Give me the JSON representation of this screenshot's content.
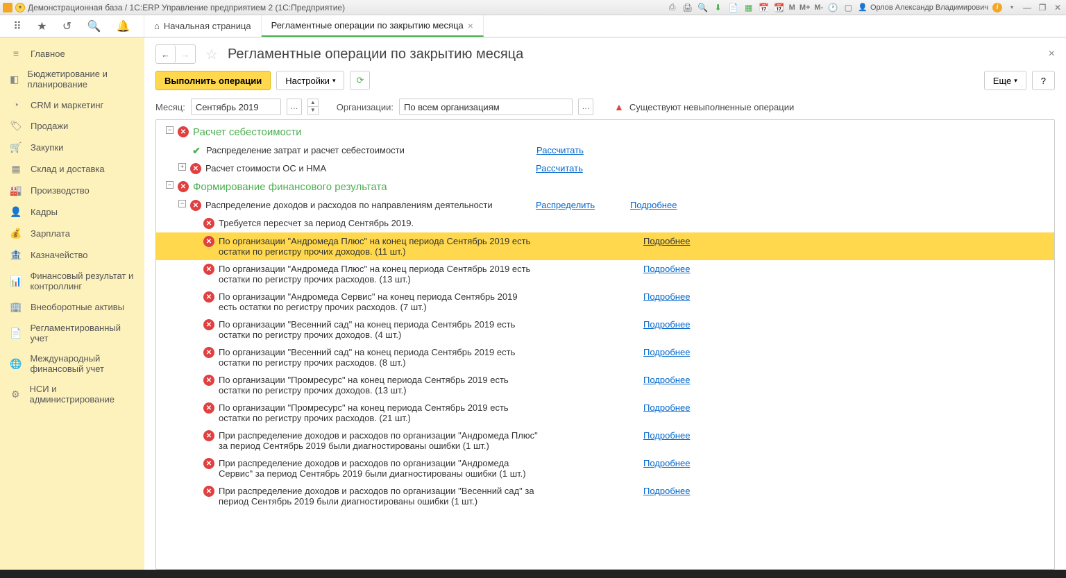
{
  "titlebar": {
    "title": "Демонстрационная база / 1С:ERP Управление предприятием 2  (1С:Предприятие)",
    "user": "Орлов Александр Владимирович",
    "m1": "M",
    "m2": "M+",
    "m3": "M-"
  },
  "tabs": {
    "home": "Начальная страница",
    "current": "Регламентные операции по закрытию месяца"
  },
  "sidebar": {
    "items": [
      {
        "icon": "≡",
        "label": "Главное"
      },
      {
        "icon": "◧",
        "label": "Бюджетирование и планирование"
      },
      {
        "icon": "◔",
        "label": "CRM и маркетинг"
      },
      {
        "icon": "🏷",
        "label": "Продажи"
      },
      {
        "icon": "🛒",
        "label": "Закупки"
      },
      {
        "icon": "▦",
        "label": "Склад и доставка"
      },
      {
        "icon": "🏭",
        "label": "Производство"
      },
      {
        "icon": "👤",
        "label": "Кадры"
      },
      {
        "icon": "💰",
        "label": "Зарплата"
      },
      {
        "icon": "🏦",
        "label": "Казначейство"
      },
      {
        "icon": "📊",
        "label": "Финансовый результат и контроллинг"
      },
      {
        "icon": "🏢",
        "label": "Внеоборотные активы"
      },
      {
        "icon": "📄",
        "label": "Регламентированный учет"
      },
      {
        "icon": "🌐",
        "label": "Международный финансовый учет"
      },
      {
        "icon": "⚙",
        "label": "НСИ и администрирование"
      }
    ]
  },
  "page": {
    "title": "Регламентные операции по закрытию месяца",
    "execute_btn": "Выполнить операции",
    "settings_btn": "Настройки",
    "more_btn": "Еще",
    "help_btn": "?",
    "month_label": "Месяц:",
    "month_value": "Сентябрь 2019",
    "org_label": "Организации:",
    "org_value": "По всем организациям",
    "warning": "Существуют невыполненные операции",
    "link_calc": "Рассчитать",
    "link_dist": "Распределить",
    "link_more": "Подробнее"
  },
  "tree": {
    "g1": {
      "text": "Расчет себестоимости"
    },
    "r1": {
      "text": "Распределение затрат и расчет себестоимости"
    },
    "r2": {
      "text": "Расчет стоимости ОС и НМА"
    },
    "g2": {
      "text": "Формирование финансового результата"
    },
    "r3": {
      "text": "Распределение доходов и расходов по направлениям деятельности"
    },
    "r4": {
      "text": "Требуется пересчет за период Сентябрь 2019."
    },
    "r5": {
      "text": "По организации \"Андромеда Плюс\" на конец периода Сентябрь 2019 есть остатки по регистру прочих доходов. (11 шт.)"
    },
    "r6": {
      "text": "По организации \"Андромеда Плюс\" на конец периода Сентябрь 2019 есть остатки по регистру прочих расходов. (13 шт.)"
    },
    "r7": {
      "text": "По организации \"Андромеда Сервис\" на конец периода Сентябрь 2019 есть остатки по регистру прочих расходов. (7 шт.)"
    },
    "r8": {
      "text": "По организации \"Весенний сад\" на конец периода Сентябрь 2019 есть остатки по регистру прочих доходов. (4 шт.)"
    },
    "r9": {
      "text": "По организации \"Весенний сад\" на конец периода Сентябрь 2019 есть остатки по регистру прочих расходов. (8 шт.)"
    },
    "r10": {
      "text": "По организации \"Промресурс\" на конец периода Сентябрь 2019 есть остатки по регистру прочих доходов. (13 шт.)"
    },
    "r11": {
      "text": "По организации \"Промресурс\" на конец периода Сентябрь 2019 есть остатки по регистру прочих расходов. (21 шт.)"
    },
    "r12": {
      "text": "При распределение доходов и расходов по организации \"Андромеда Плюс\" за период Сентябрь 2019 были диагностированы ошибки (1 шт.)"
    },
    "r13": {
      "text": "При распределение доходов и расходов по организации \"Андромеда Сервис\" за период Сентябрь 2019 были диагностированы ошибки (1 шт.)"
    },
    "r14": {
      "text": "При распределение доходов и расходов по организации \"Весенний сад\" за период Сентябрь 2019 были диагностированы ошибки (1 шт.)"
    }
  }
}
